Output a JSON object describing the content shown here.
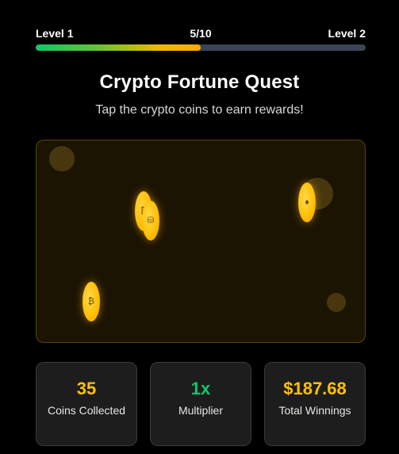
{
  "progress": {
    "left_label": "Level 1",
    "center_label": "5/10",
    "right_label": "Level 2",
    "fraction": 0.5
  },
  "title": "Crypto Fortune Quest",
  "subtitle": "Tap the crypto coins to earn rewards!",
  "coins": [
    {
      "icon": "bitcoin-icon",
      "glyph": "₿"
    },
    {
      "icon": "coin-stack-icon",
      "glyph": "⛁"
    },
    {
      "icon": "ethereum-icon",
      "glyph": "♦"
    },
    {
      "icon": "bitcoin-icon",
      "glyph": "₿"
    }
  ],
  "stats": {
    "coins": {
      "value": "35",
      "label": "Coins Collected"
    },
    "multiplier": {
      "value": "1x",
      "label": "Multiplier"
    },
    "winnings": {
      "value": "$187.68",
      "label": "Total Winnings"
    }
  },
  "colors": {
    "accent_yellow": "#ffc107",
    "accent_green": "#10c76a",
    "background": "#000000",
    "game_area": "#1c1403"
  }
}
